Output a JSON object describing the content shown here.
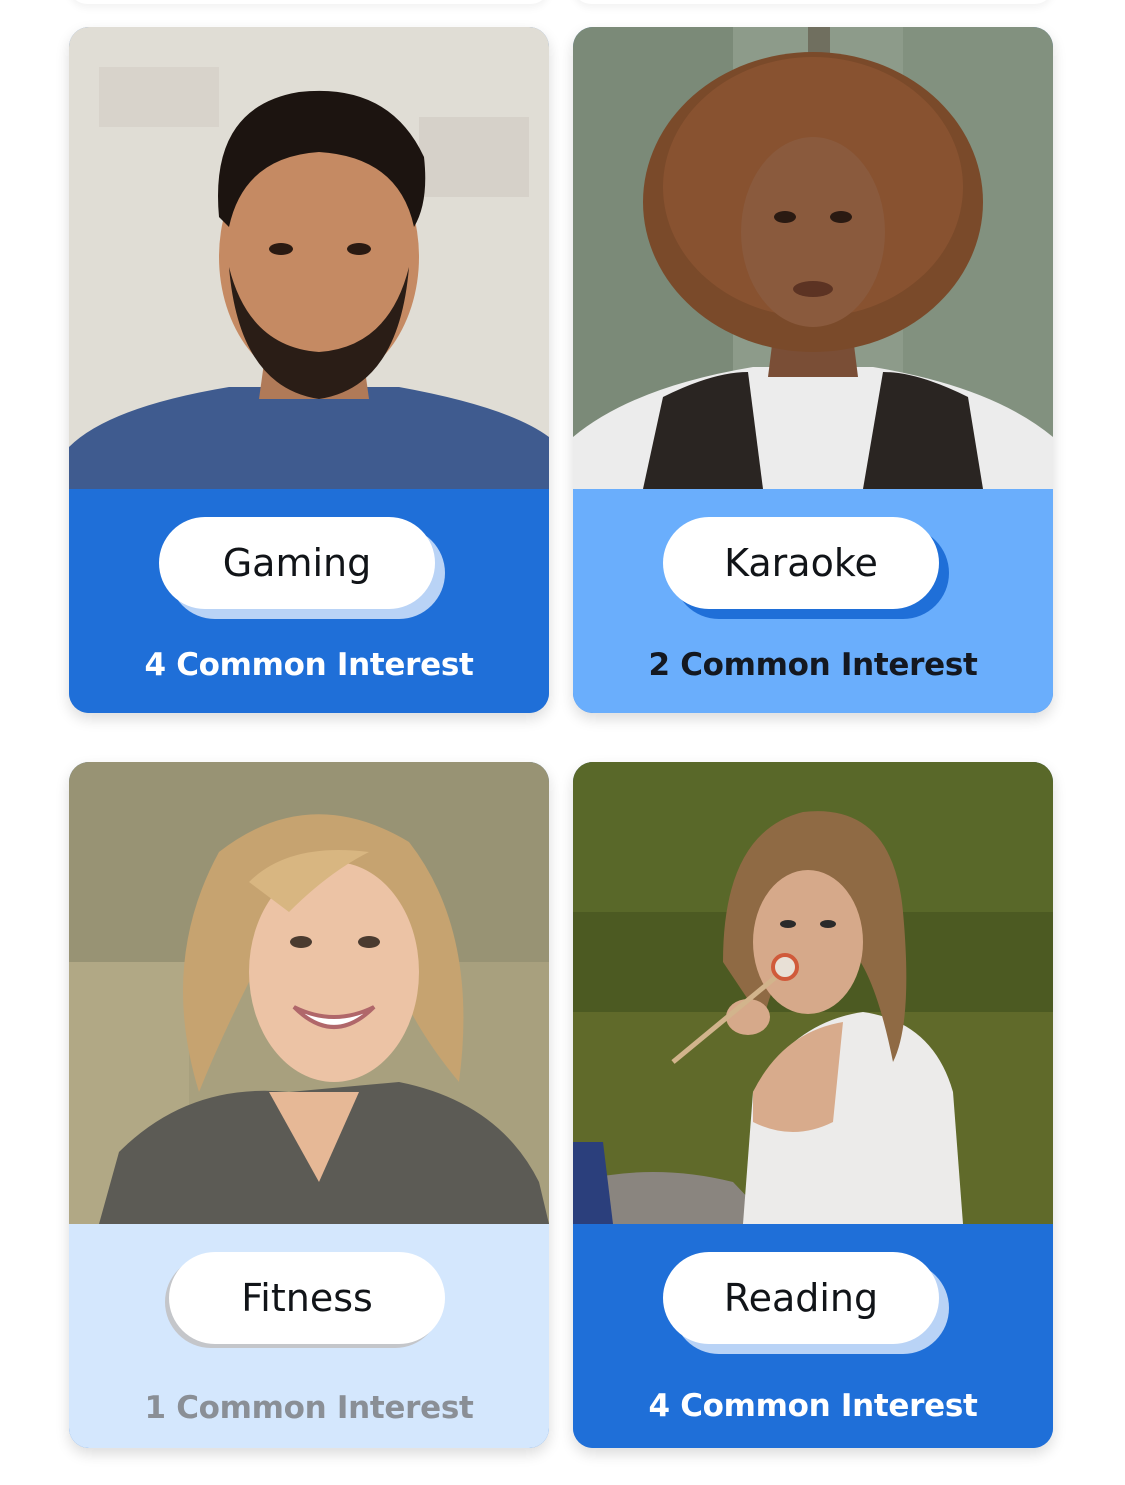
{
  "colors": {
    "primary": "#1f6fd8",
    "medium": "#6aaefc",
    "light": "#d4e7fd",
    "pill": "#ffffff",
    "muted_text": "#8a8f96"
  },
  "cards": [
    {
      "interest_tag": "Gaming",
      "common_interest": "4 Common Interest",
      "photo": "man-with-beard-portrait"
    },
    {
      "interest_tag": "Karaoke",
      "common_interest": "2 Common Interest",
      "photo": "woman-curly-hair-portrait"
    },
    {
      "interest_tag": "Fitness",
      "common_interest": "1 Common Interest",
      "photo": "blonde-woman-smiling-portrait"
    },
    {
      "interest_tag": "Reading",
      "common_interest": "4 Common Interest",
      "photo": "woman-on-grass-portrait"
    }
  ]
}
